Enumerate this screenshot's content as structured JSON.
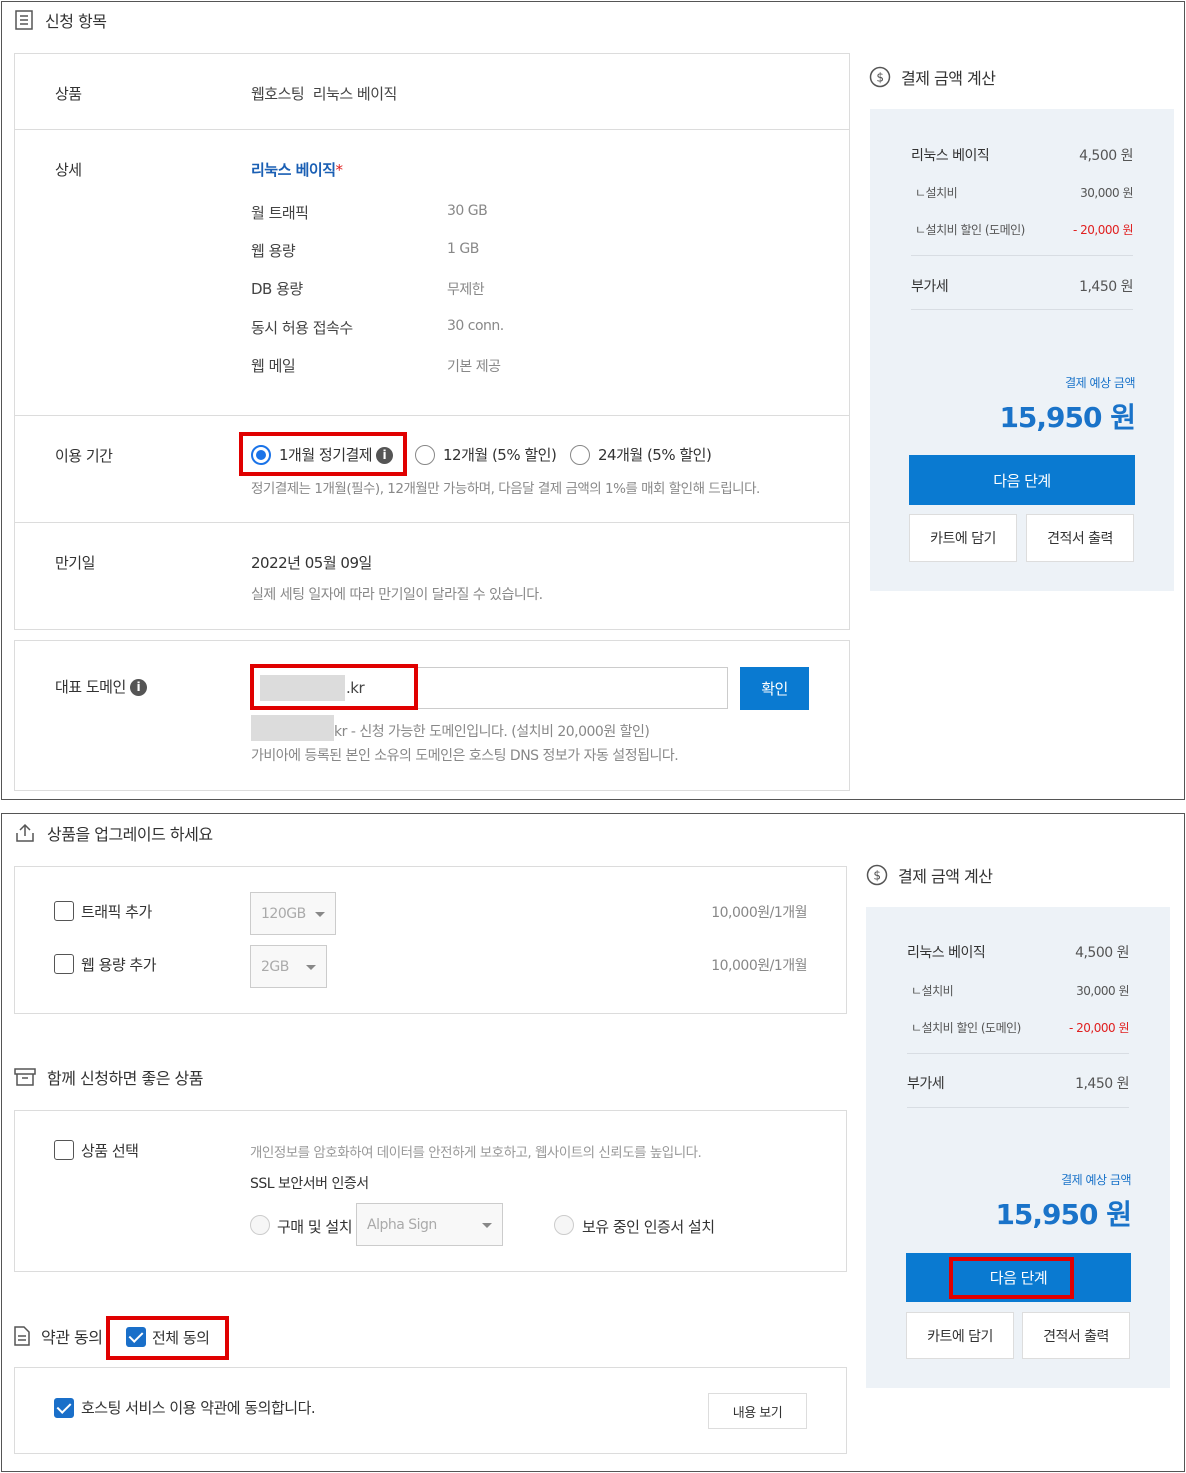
{
  "top": {
    "section_title": "신청 항목",
    "product_label": "상품",
    "product_value": "웹호스팅  리눅스 베이직",
    "detail_label": "상세",
    "detail_title": "리눅스 베이직",
    "detail_star": "*",
    "specs": [
      {
        "k": "월 트래픽",
        "v": "30 GB"
      },
      {
        "k": "웹 용량",
        "v": "1 GB"
      },
      {
        "k": "DB 용량",
        "v": "무제한"
      },
      {
        "k": "동시 허용 접속수",
        "v": "30 conn."
      },
      {
        "k": "웹 메일",
        "v": "기본 제공"
      }
    ],
    "period_label": "이용 기간",
    "period_options": [
      "1개월 정기결제",
      "12개월 (5% 할인)",
      "24개월 (5% 할인)"
    ],
    "period_note": "정기결제는 1개월(필수), 12개월만 가능하며, 다음달 결제 금액의 1%를 매회 할인해 드립니다.",
    "expiry_label": "만기일",
    "expiry_value": "2022년 05월 09일",
    "expiry_note": "실제 세팅 일자에 따라 만기일이 달라질 수 있습니다.",
    "domain_label": "대표 도메인",
    "domain_suffix": ".kr",
    "confirm_button": "확인",
    "domain_note1": "kr - 신청 가능한 도메인입니다. (설치비 20,000원 할인)",
    "domain_note2": "가비아에 등록된 본인 소유의 도메인은 호스팅 DNS 정보가 자동 설정됩니다."
  },
  "calc": {
    "title": "결제 금액 계산",
    "item_label": "리눅스 베이직",
    "item_value": "4,500 원",
    "setup_label": "ㄴ설치비",
    "setup_value": "30,000 원",
    "discount_label": "ㄴ설치비 할인 (도메인)",
    "discount_value": "- 20,000 원",
    "vat_label": "부가세",
    "vat_value": "1,450 원",
    "total_label": "결제 예상 금액",
    "total_value": "15,950 원",
    "next_button": "다음 단계",
    "cart_button": "카트에 담기",
    "quote_button": "견적서 출력"
  },
  "bottom": {
    "upgrade_title": "상품을 업그레이드 하세요",
    "traffic_label": "트래픽 추가",
    "traffic_select": "120GB",
    "traffic_price": "10,000원/1개월",
    "webcap_label": "웹 용량 추가",
    "webcap_select": "2GB",
    "webcap_price": "10,000원/1개월",
    "together_title": "함께 신청하면 좋은 상품",
    "select_product_label": "상품 선택",
    "ssl_desc": "개인정보를 암호화하여 데이터를 안전하게 보호하고, 웹사이트의 신뢰도를 높입니다.",
    "ssl_title": "SSL 보안서버 인증서",
    "ssl_buy": "구매 및 설치",
    "ssl_select": "Alpha Sign",
    "ssl_own": "보유 중인 인증서 설치",
    "terms_title": "약관 동의",
    "agree_all": "전체 동의",
    "terms_item": "호스팅 서비스 이용 약관에 동의합니다.",
    "view_button": "내용 보기"
  }
}
